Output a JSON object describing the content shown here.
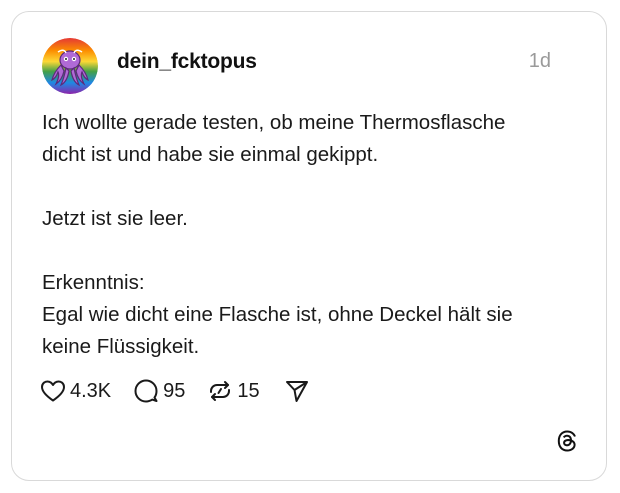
{
  "post": {
    "username": "dein_fcktopus",
    "time": "1d",
    "text": {
      "p1_line1": "Ich wollte gerade testen, ob meine Thermosflasche",
      "p1_line2": "dicht ist und habe sie einmal gekippt.",
      "p2_line1": "Jetzt ist sie leer.",
      "p3_line1": "Erkenntnis:",
      "p3_line2": "Egal wie dicht eine Flasche ist, ohne Deckel hält sie",
      "p3_line3": "keine Flüssigkeit."
    }
  },
  "actions": {
    "likes": "4.3K",
    "replies": "95",
    "reposts": "15"
  },
  "icons": {
    "like": "heart-icon",
    "reply": "comment-icon",
    "repost": "repost-icon",
    "share": "send-icon",
    "brand": "threads-logo-icon"
  },
  "colors": {
    "text": "#1a1a1a",
    "muted": "#9a9a9a",
    "border": "#d9d9d9"
  }
}
